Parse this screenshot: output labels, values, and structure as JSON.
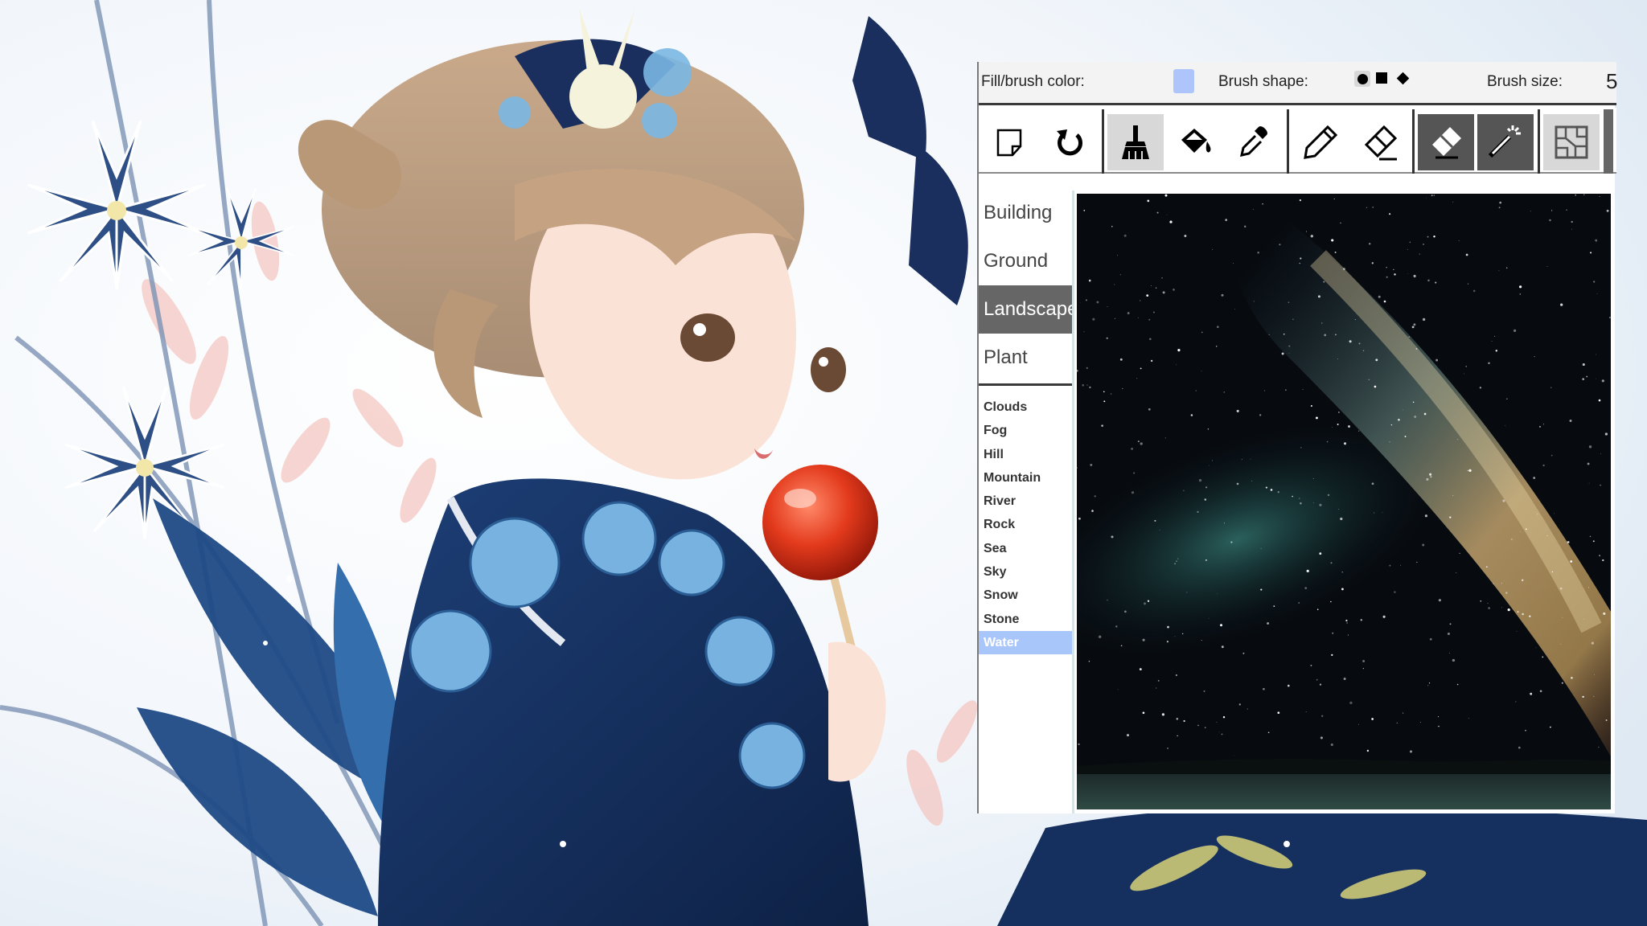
{
  "settings": {
    "fill_label": "Fill/brush color:",
    "fill_color": "#aec5fb",
    "shape_label": "Brush shape:",
    "shapes": [
      "circle-shape",
      "square-shape",
      "diamond-shape"
    ],
    "selected_shape": "circle-shape",
    "size_label": "Brush size:",
    "size_value": "5"
  },
  "toolbar": {
    "tools": [
      "new-page-icon",
      "undo-icon",
      "brush-icon",
      "paint-bucket-icon",
      "eyedropper-icon",
      "pencil-icon",
      "line-eraser-icon",
      "eraser-icon",
      "magic-wand-icon",
      "segment-grid-icon"
    ],
    "active_tool": "brush-icon"
  },
  "categories": {
    "items": [
      "Building",
      "Ground",
      "Landscape",
      "Plant"
    ],
    "selected": "Landscape"
  },
  "labels": {
    "items": [
      "Clouds",
      "Fog",
      "Hill",
      "Mountain",
      "River",
      "Rock",
      "Sea",
      "Sky",
      "Snow",
      "Stone",
      "Water"
    ],
    "selected": "Water"
  },
  "colors": {
    "panel_bg": "#ffffff",
    "selected_category_bg": "#666666",
    "selected_label_bg": "#a9c6fb",
    "canvas_bg": "#070b10"
  }
}
